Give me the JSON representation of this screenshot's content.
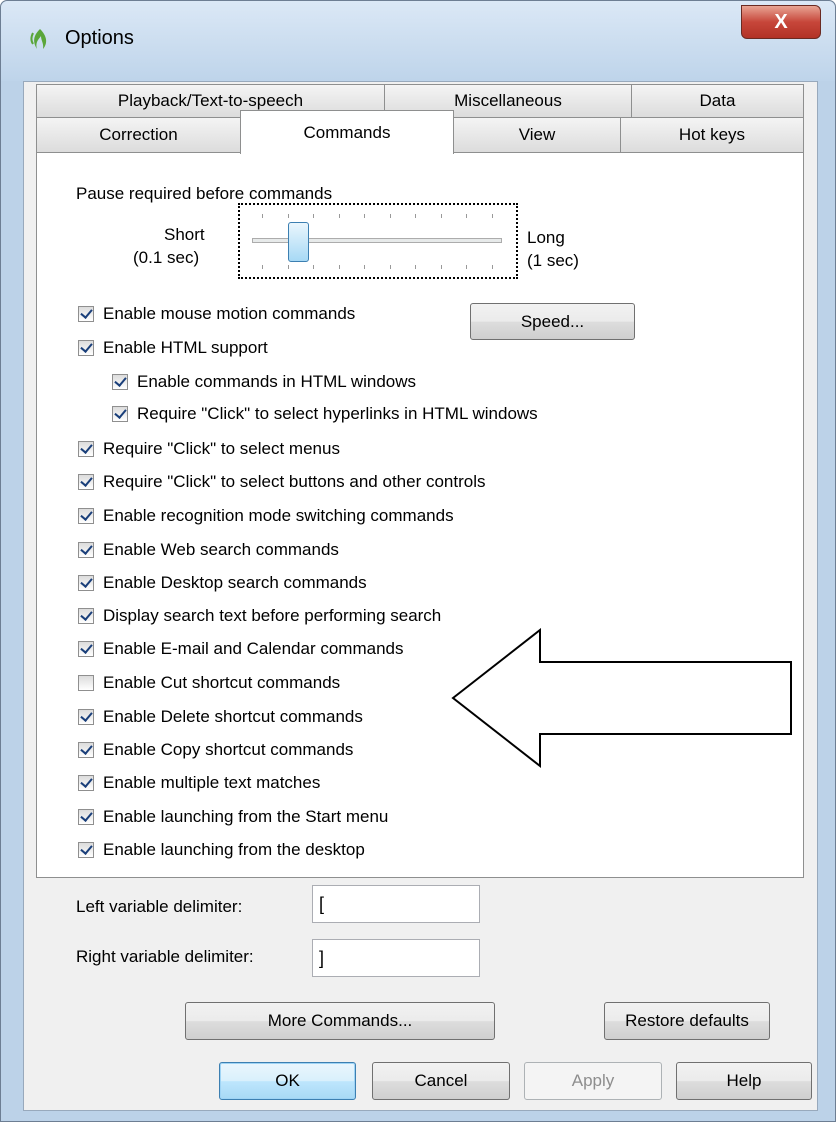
{
  "window": {
    "title": "Options",
    "close_label": "X"
  },
  "tabs": {
    "back": [
      "Playback/Text-to-speech",
      "Miscellaneous",
      "Data"
    ],
    "front": [
      "Correction",
      "Commands",
      "View",
      "Hot keys"
    ],
    "active": "Commands"
  },
  "pause": {
    "label": "Pause required before commands",
    "min_label_1": "Short",
    "min_label_2": "(0.1 sec)",
    "max_label_1": "Long",
    "max_label_2": "(1 sec)",
    "slider_value_fraction": 0.2
  },
  "speed_button": "Speed...",
  "checkboxes": [
    {
      "label": "Enable mouse motion commands",
      "checked": true
    },
    {
      "label": "Enable HTML support",
      "checked": true
    },
    {
      "label": "Enable commands in HTML windows",
      "checked": true
    },
    {
      "label": "Require \"Click\" to select hyperlinks in HTML windows",
      "checked": true
    },
    {
      "label": "Require \"Click\" to select menus",
      "checked": true
    },
    {
      "label": "Require \"Click\" to select buttons and other controls",
      "checked": true
    },
    {
      "label": "Enable recognition mode switching commands",
      "checked": true
    },
    {
      "label": "Enable Web search commands",
      "checked": true
    },
    {
      "label": "Enable Desktop search commands",
      "checked": true
    },
    {
      "label": "Display search text before performing search",
      "checked": true
    },
    {
      "label": "Enable E-mail and Calendar commands",
      "checked": true
    },
    {
      "label": "Enable Cut shortcut commands",
      "checked": false
    },
    {
      "label": "Enable Delete shortcut commands",
      "checked": true
    },
    {
      "label": "Enable Copy shortcut commands",
      "checked": true
    },
    {
      "label": "Enable multiple text matches",
      "checked": true
    },
    {
      "label": "Enable launching from the Start menu",
      "checked": true
    },
    {
      "label": "Enable launching from the desktop",
      "checked": true
    }
  ],
  "delimiters": {
    "left_label": "Left variable delimiter:",
    "left_value": "[",
    "right_label": "Right variable delimiter:",
    "right_value": "]"
  },
  "buttons": {
    "more_commands": "More Commands...",
    "restore_defaults": "Restore defaults",
    "ok": "OK",
    "cancel": "Cancel",
    "apply": "Apply",
    "help": "Help"
  },
  "colors": {
    "accent": "#3c7fb1",
    "close_button": "#c7463a",
    "checkmark": "#1a3f7a"
  },
  "icons": {
    "app": "dragon-flame-icon",
    "close": "close-icon",
    "annotation": "left-arrow-outline-icon"
  }
}
